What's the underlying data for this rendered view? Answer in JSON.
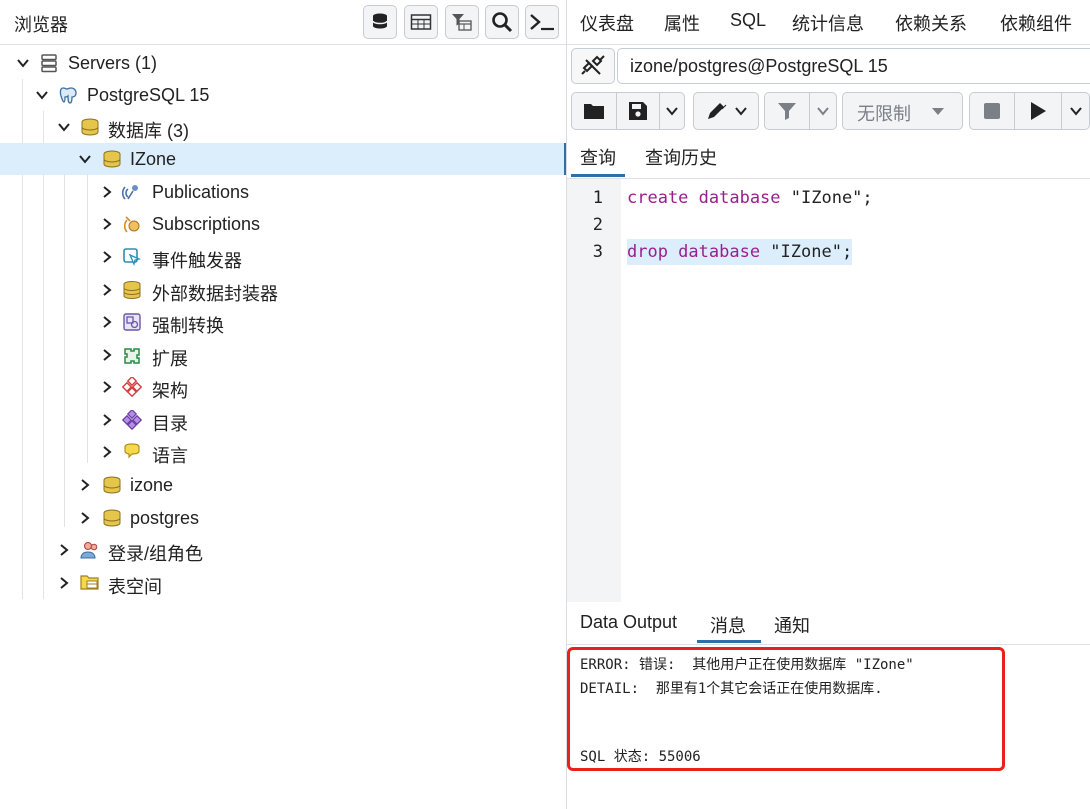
{
  "browser": {
    "title": "浏览器",
    "toolbar_icons": [
      "database-icon",
      "table-icon",
      "filter-table-icon",
      "search-icon",
      "terminal-icon"
    ],
    "tree": [
      {
        "label": "Servers (1)",
        "icon": "servers-icon",
        "expanded": true
      },
      {
        "label": "PostgreSQL 15",
        "icon": "elephant-icon",
        "expanded": true
      },
      {
        "label": "数据库 (3)",
        "icon": "databases-icon",
        "expanded": true
      },
      {
        "label": "IZone",
        "icon": "database-icon",
        "expanded": true,
        "selected": true
      },
      {
        "label": "Publications",
        "icon": "publication-icon",
        "expanded": false
      },
      {
        "label": "Subscriptions",
        "icon": "subscription-icon",
        "expanded": false
      },
      {
        "label": "事件触发器",
        "icon": "event-trigger-icon",
        "expanded": false
      },
      {
        "label": "外部数据封装器",
        "icon": "fdw-icon",
        "expanded": false
      },
      {
        "label": "强制转换",
        "icon": "cast-icon",
        "expanded": false
      },
      {
        "label": "扩展",
        "icon": "extension-icon",
        "expanded": false
      },
      {
        "label": "架构",
        "icon": "schema-icon",
        "expanded": false
      },
      {
        "label": "目录",
        "icon": "catalog-icon",
        "expanded": false
      },
      {
        "label": "语言",
        "icon": "language-icon",
        "expanded": false
      },
      {
        "label": "izone",
        "icon": "database-icon",
        "expanded": false
      },
      {
        "label": "postgres",
        "icon": "database-icon",
        "expanded": false
      },
      {
        "label": "登录/组角色",
        "icon": "roles-icon",
        "expanded": false
      },
      {
        "label": "表空间",
        "icon": "tablespace-icon",
        "expanded": false
      }
    ]
  },
  "top_tabs": [
    "仪表盘",
    "属性",
    "SQL",
    "统计信息",
    "依赖关系",
    "依赖组件"
  ],
  "connection": {
    "value": "izone/postgres@PostgreSQL 15",
    "icon": "disconnect-icon"
  },
  "query_toolbar": {
    "limit_label": "无限制"
  },
  "query_tabs": [
    "查询",
    "查询历史"
  ],
  "editor": {
    "line_numbers": [
      "1",
      "2",
      "3"
    ],
    "lines": [
      {
        "kw": "create database",
        "rest": " \"IZone\";"
      },
      {
        "kw": "",
        "rest": ""
      },
      {
        "kw": "drop database",
        "rest": " \"IZone\";"
      }
    ]
  },
  "bottom_tabs": [
    "Data Output",
    "消息",
    "通知"
  ],
  "messages": {
    "error": "ERROR: 错误:  其他用户正在使用数据库 \"IZone\"",
    "detail": "DETAIL:  那里有1个其它会话正在使用数据库.",
    "sqlstate": "SQL 状态: 55006"
  },
  "colors": {
    "accent": "#2f6fa7",
    "selection": "#dceefc",
    "keyword": "#9a1e8c",
    "highlight_box": "#e8221a"
  }
}
